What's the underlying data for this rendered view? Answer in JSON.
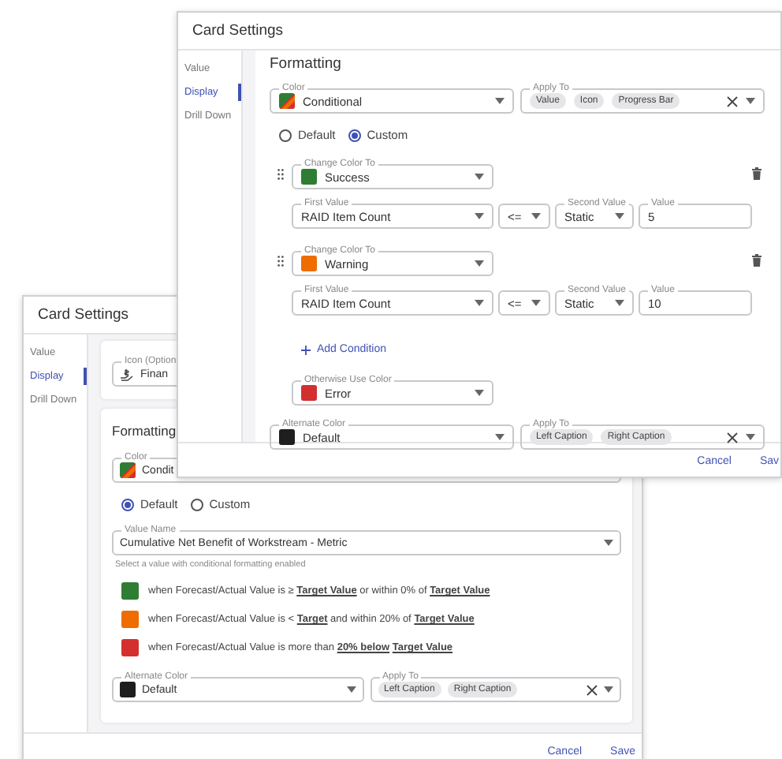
{
  "back_window": {
    "title": "Card Settings",
    "sidebar": [
      {
        "label": "Value",
        "selected": false
      },
      {
        "label": "Display",
        "selected": true
      },
      {
        "label": "Drill Down",
        "selected": false
      }
    ],
    "icon_field": {
      "label": "Icon (Option",
      "value": "Finan"
    },
    "formatting": {
      "title": "Formatting",
      "color": {
        "label": "Color",
        "value": "Condit"
      },
      "radios": [
        {
          "label": "Default",
          "selected": true
        },
        {
          "label": "Custom",
          "selected": false
        }
      ],
      "value_name": {
        "label": "Value Name",
        "value": "Cumulative Net Benefit of Workstream - Metric"
      },
      "helper": "Select a value with conditional formatting enabled",
      "rules": [
        {
          "color": "#2e7d32",
          "text": "when Forecast/Actual Value is ≥ **Target Value** or within 0% of **Target Value**"
        },
        {
          "color": "#ef6c00",
          "text": "when Forecast/Actual Value is < **Target** and within 20% of **Target Value**"
        },
        {
          "color": "#d32f2f",
          "text": "when Forecast/Actual Value is more than **20% below** **Target Value**"
        }
      ],
      "alternate_color": {
        "label": "Alternate Color",
        "value": "Default",
        "color": "#1e1e1e"
      },
      "apply_to": {
        "label": "Apply To",
        "chips": [
          "Left Caption",
          "Right Caption"
        ]
      }
    },
    "footer_buttons": [
      "Cancel",
      "Save"
    ]
  },
  "front_window": {
    "title": "Card Settings",
    "sidebar": [
      {
        "label": "Value",
        "selected": false
      },
      {
        "label": "Display",
        "selected": true
      },
      {
        "label": "Drill Down",
        "selected": false
      }
    ],
    "formatting": {
      "title": "Formatting",
      "color": {
        "label": "Color",
        "value": "Conditional"
      },
      "apply_to": {
        "label": "Apply To",
        "chips": [
          "Value",
          "Icon",
          "Progress Bar"
        ]
      },
      "radios": [
        {
          "label": "Default",
          "selected": false
        },
        {
          "label": "Custom",
          "selected": true
        }
      ],
      "conditions": [
        {
          "change_label": "Change Color To",
          "color": "#2e7d32",
          "color_name": "Success",
          "first_label": "First Value",
          "first_value": "RAID Item Count",
          "operator": "<=",
          "second_label": "Second Value",
          "second_value": "Static",
          "value_label": "Value",
          "value": "5"
        },
        {
          "change_label": "Change Color To",
          "color": "#ef6c00",
          "color_name": "Warning",
          "first_label": "First Value",
          "first_value": "RAID Item Count",
          "operator": "<=",
          "second_label": "Second Value",
          "second_value": "Static",
          "value_label": "Value",
          "value": "10"
        }
      ],
      "add_condition": "Add Condition",
      "otherwise": {
        "label": "Otherwise Use Color",
        "value": "Error",
        "color": "#d32f2f"
      },
      "alternate_color": {
        "label": "Alternate Color",
        "value": "Default",
        "color": "#1e1e1e"
      },
      "apply_to_2": {
        "label": "Apply To",
        "chips": [
          "Left Caption",
          "Right Caption"
        ]
      }
    },
    "footer_buttons": [
      "Cancel",
      "Sav"
    ]
  }
}
